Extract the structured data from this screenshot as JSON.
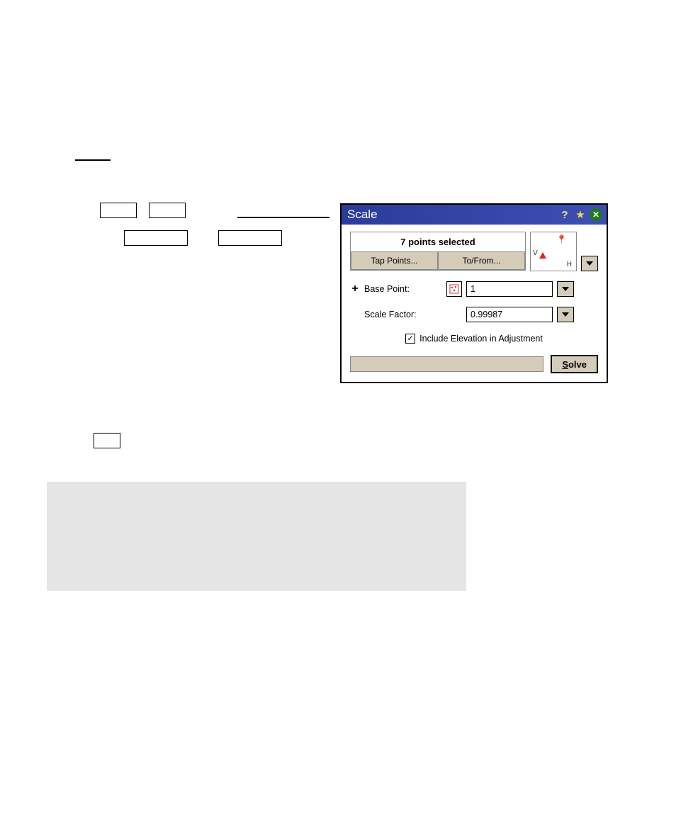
{
  "dialog": {
    "title": "Scale",
    "selection_label": "7 points selected",
    "tap_btn": "Tap Points...",
    "tofrom_btn": "To/From...",
    "preview": {
      "v": "V",
      "h": "H"
    },
    "base_point": {
      "label": "Base Point:",
      "value": "1"
    },
    "scale_factor": {
      "label": "Scale Factor:",
      "value": "0.99987"
    },
    "checkbox": {
      "label": "Include Elevation in Adjustment",
      "checked": true
    },
    "solve_prefix": "S",
    "solve_rest": "olve"
  }
}
